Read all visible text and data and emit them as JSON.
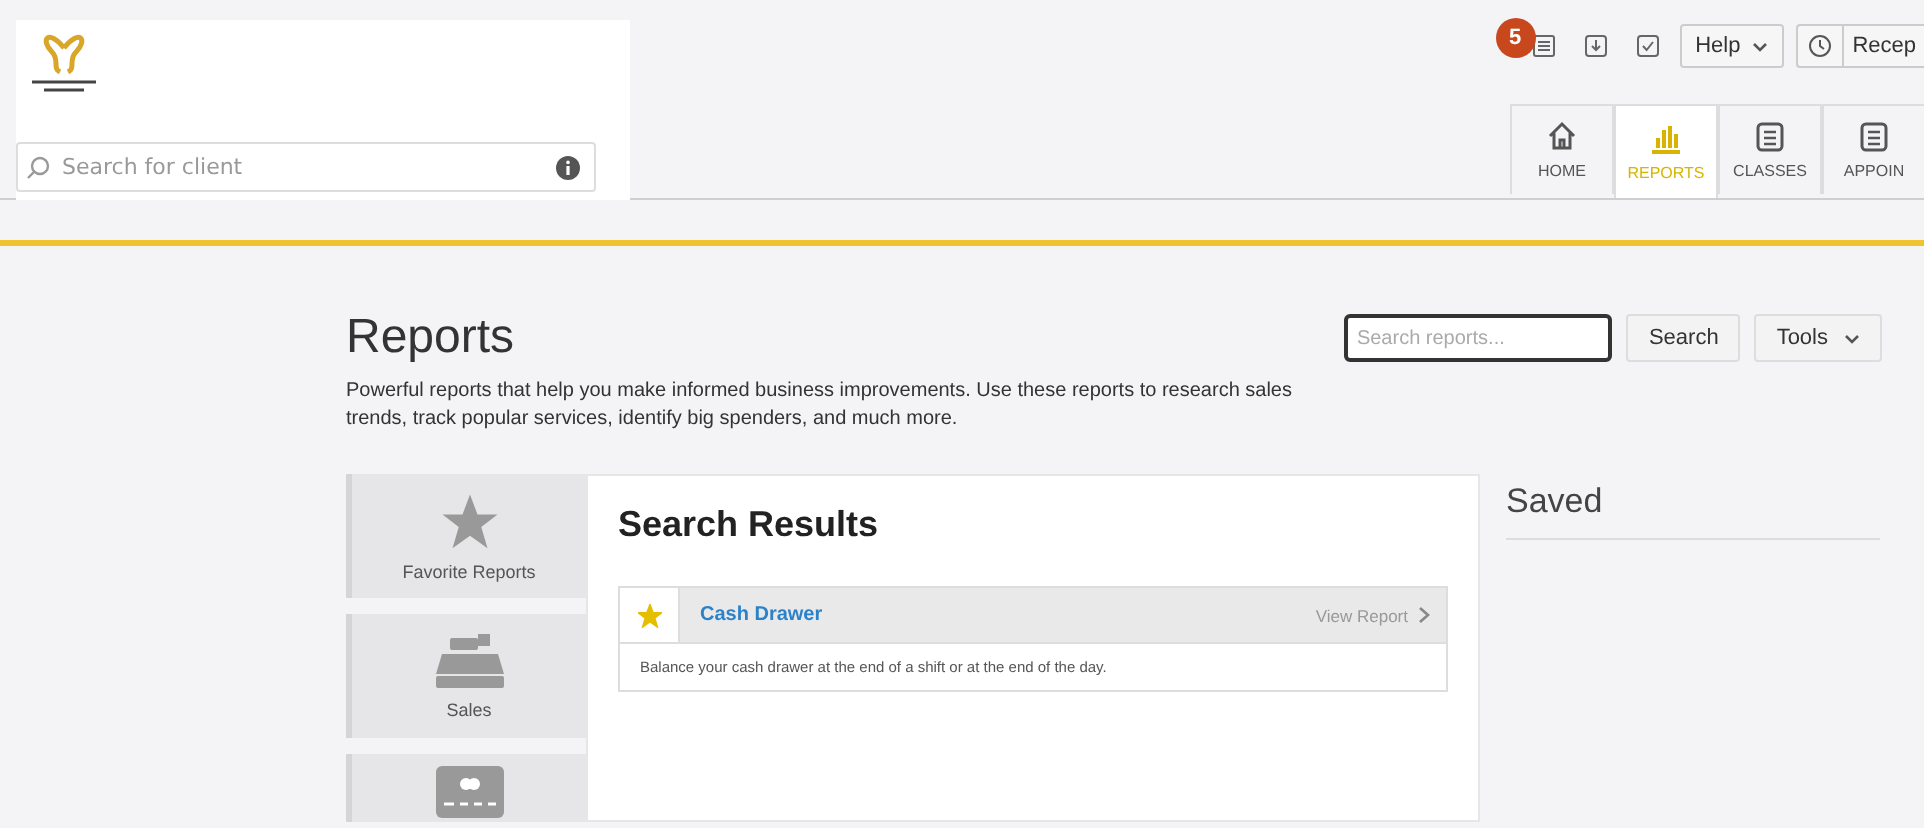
{
  "header": {
    "search": {
      "placeholder": "Search for client"
    },
    "notification_count": "5",
    "help_label": "Help",
    "role_label": "Recep",
    "tabs": [
      {
        "label": "HOME",
        "kind": "home",
        "selected": false
      },
      {
        "label": "REPORTS",
        "kind": "chart",
        "selected": true
      },
      {
        "label": "CLASSES",
        "kind": "calendar",
        "selected": false
      },
      {
        "label": "APPOIN",
        "kind": "calendar",
        "selected": false
      }
    ]
  },
  "page": {
    "title": "Reports",
    "description": "Powerful reports that help you make informed business improvements. Use these reports to research sales trends, track popular services, identify big spenders, and much more.",
    "search": {
      "placeholder": "Search reports..."
    },
    "search_button": "Search",
    "tools_button": "Tools"
  },
  "categories": [
    {
      "label": "Favorite Reports",
      "kind": "star"
    },
    {
      "label": "Sales",
      "kind": "register"
    },
    {
      "kind": "card"
    }
  ],
  "results": {
    "title": "Search Results",
    "items": [
      {
        "name": "Cash Drawer",
        "favorite": true,
        "link": "View Report",
        "description": "Balance your cash drawer at the end of a shift or at the end of the day."
      }
    ]
  },
  "saved": {
    "title": "Saved"
  }
}
